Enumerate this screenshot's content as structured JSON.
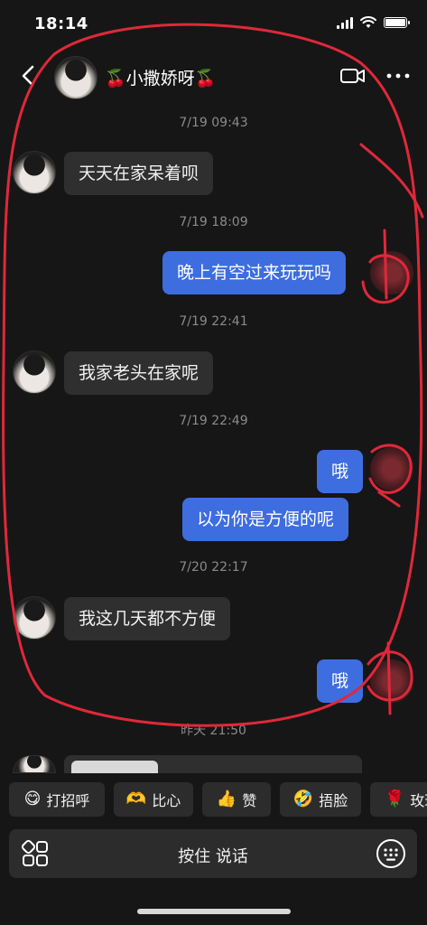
{
  "status_bar": {
    "time": "18:14"
  },
  "header": {
    "title": "🍒小撒娇呀🍒",
    "back_icon": "chevron-left-icon",
    "video_icon": "video-camera-icon",
    "more_icon": "ellipsis-icon"
  },
  "messages": [
    {
      "type": "time",
      "text": "7/19 09:43"
    },
    {
      "type": "in",
      "text": "天天在家呆着呗"
    },
    {
      "type": "time",
      "text": "7/19 18:09"
    },
    {
      "type": "out",
      "text": "晚上有空过来玩玩吗"
    },
    {
      "type": "time",
      "text": "7/19 22:41"
    },
    {
      "type": "in",
      "text": "我家老头在家呢"
    },
    {
      "type": "time",
      "text": "7/19 22:49"
    },
    {
      "type": "out",
      "text": "哦"
    },
    {
      "type": "out",
      "text": "以为你是方便的呢"
    },
    {
      "type": "time",
      "text": "7/20 22:17"
    },
    {
      "type": "in",
      "text": "我这几天都不方便"
    },
    {
      "type": "out",
      "text": "哦"
    },
    {
      "type": "time",
      "text": "昨天 21:50"
    }
  ],
  "quick_replies": [
    {
      "emoji": "😋",
      "label": "打招呼"
    },
    {
      "emoji": "🫶",
      "label": "比心"
    },
    {
      "emoji": "👍",
      "label": "赞"
    },
    {
      "emoji": "🤣",
      "label": "捂脸"
    },
    {
      "emoji": "🌹",
      "label": "玫瑰"
    }
  ],
  "input_bar": {
    "hold_to_talk": "按住 说话",
    "grid_icon": "apps-grid-icon",
    "keyboard_icon": "keyboard-icon"
  },
  "colors": {
    "background": "#161616",
    "incoming_bubble": "#2f2f2f",
    "outgoing_bubble": "#3e6de0",
    "annotation_red": "#e0283a"
  }
}
